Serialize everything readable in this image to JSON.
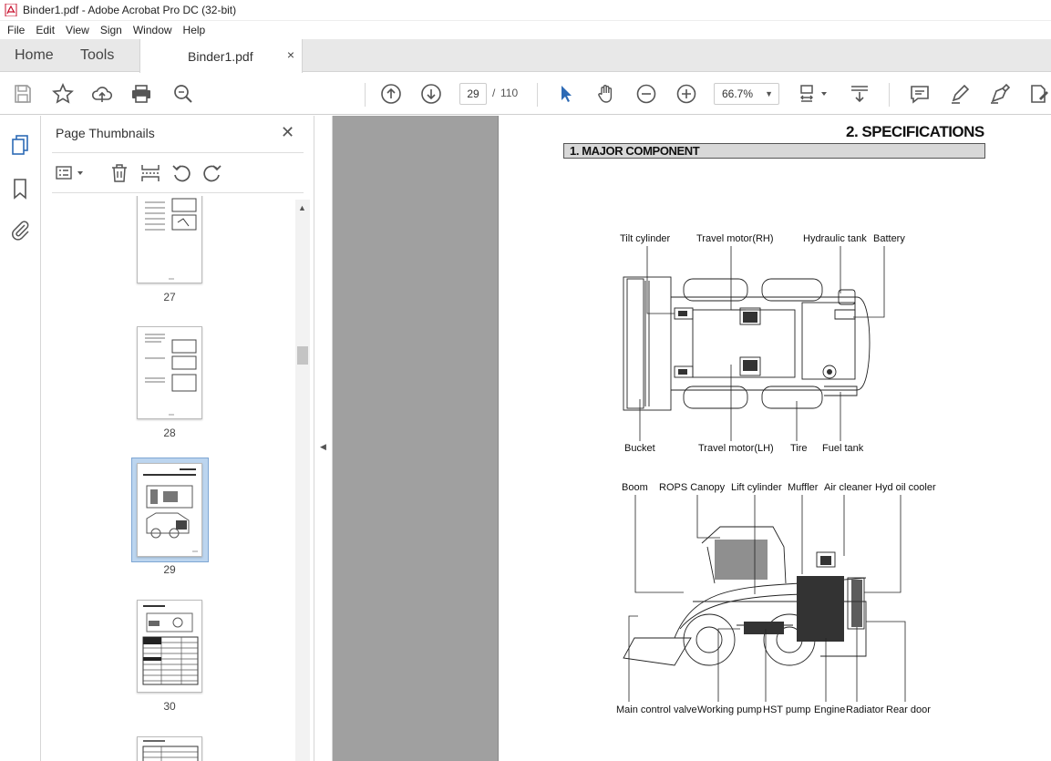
{
  "window": {
    "title": "Binder1.pdf - Adobe Acrobat Pro DC (32-bit)"
  },
  "menu": [
    "File",
    "Edit",
    "View",
    "Sign",
    "Window",
    "Help"
  ],
  "tabs": {
    "home": "Home",
    "tools": "Tools",
    "document": "Binder1.pdf",
    "close": "×"
  },
  "toolbar": {
    "current_page": "29",
    "page_separator": "/",
    "total_pages": "110",
    "zoom": "66.7%"
  },
  "panel": {
    "title": "Page Thumbnails",
    "close": "✕",
    "thumbnails": [
      {
        "page": "27"
      },
      {
        "page": "28"
      },
      {
        "page": "29",
        "selected": true
      },
      {
        "page": "30"
      }
    ]
  },
  "pdf": {
    "heading": "2. SPECIFICATIONS",
    "section": "1. MAJOR COMPONENT",
    "top_labels": [
      "Tilt cylinder",
      "Travel motor(RH)",
      "Hydraulic tank",
      "Battery"
    ],
    "top_bottom_labels": [
      "Bucket",
      "Travel motor(LH)",
      "Tire",
      "Fuel tank"
    ],
    "side_top_labels": [
      "Boom",
      "ROPS Canopy",
      "Lift cylinder",
      "Muffler",
      "Air cleaner",
      "Hyd oil cooler"
    ],
    "side_bottom_labels": [
      "Main control valve",
      "Working pump",
      "HST pump",
      "Engine",
      "Radiator",
      "Rear door"
    ]
  },
  "colors": {
    "accent": "#2d6ab5",
    "tab_bar": "#e8e8e8",
    "canvas": "#a0a0a0"
  }
}
